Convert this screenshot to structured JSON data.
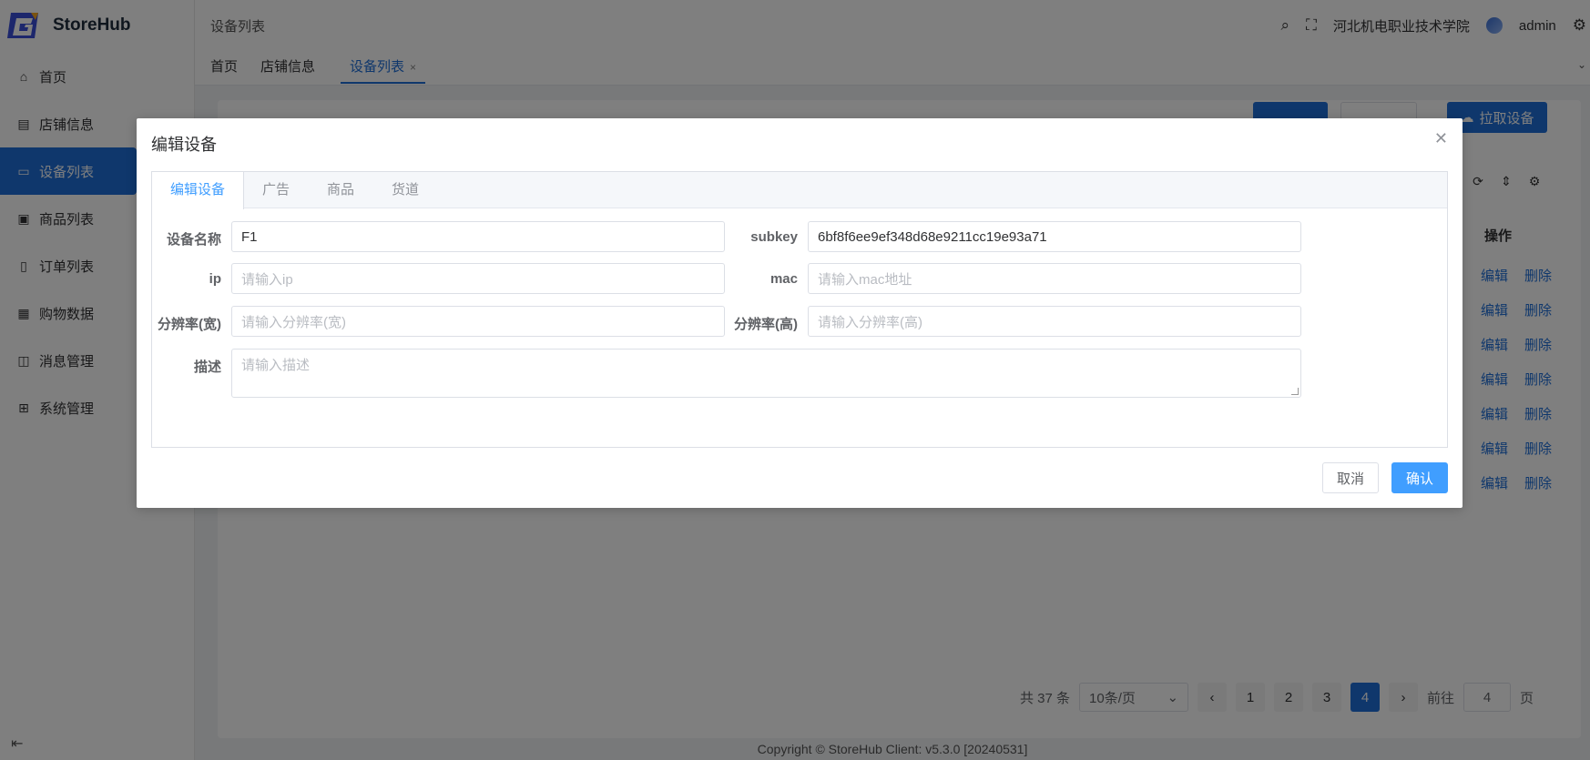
{
  "app": {
    "name": "StoreHub"
  },
  "sidebar": {
    "items": [
      {
        "label": "首页",
        "icon": "home-icon"
      },
      {
        "label": "店铺信息",
        "icon": "store-icon"
      },
      {
        "label": "设备列表",
        "icon": "monitor-icon",
        "active": true
      },
      {
        "label": "商品列表",
        "icon": "image-icon"
      },
      {
        "label": "订单列表",
        "icon": "document-icon"
      },
      {
        "label": "购物数据",
        "icon": "ticket-icon"
      },
      {
        "label": "消息管理",
        "icon": "message-icon"
      },
      {
        "label": "系统管理",
        "icon": "grid-icon"
      }
    ]
  },
  "header": {
    "breadcrumb": "设备列表",
    "org": "河北机电职业技术学院",
    "user": "admin"
  },
  "tags": {
    "home": "首页",
    "store": "店铺信息",
    "devices": "设备列表",
    "close": "×"
  },
  "toolbar": {
    "pull_devices": "拉取设备"
  },
  "table": {
    "op_header": "操作",
    "edit": "编辑",
    "delete": "删除",
    "row_count": 7
  },
  "pagination": {
    "total": "共 37 条",
    "page_size": "10条/页",
    "pages": [
      "1",
      "2",
      "3",
      "4"
    ],
    "current": "4",
    "goto_prefix": "前往",
    "goto_value": "4",
    "goto_suffix": "页"
  },
  "footer": {
    "copyright": "Copyright © StoreHub Client: v5.3.0 [20240531]"
  },
  "dialog": {
    "title": "编辑设备",
    "tabs": [
      "编辑设备",
      "广告",
      "商品",
      "货道"
    ],
    "fields": {
      "name_label": "设备名称",
      "name_value": "F1",
      "subkey_label": "subkey",
      "subkey_value": "6bf8f6ee9ef348d68e9211cc19e93a71",
      "ip_label": "ip",
      "ip_placeholder": "请输入ip",
      "mac_label": "mac",
      "mac_placeholder": "请输入mac地址",
      "width_label": "分辨率(宽)",
      "width_placeholder": "请输入分辨率(宽)",
      "height_label": "分辨率(高)",
      "height_placeholder": "请输入分辨率(高)",
      "desc_label": "描述",
      "desc_placeholder": "请输入描述"
    },
    "cancel": "取消",
    "confirm": "确认"
  },
  "colors": {
    "primary": "#409eff",
    "sidebar_active": "#1e6fd9"
  }
}
